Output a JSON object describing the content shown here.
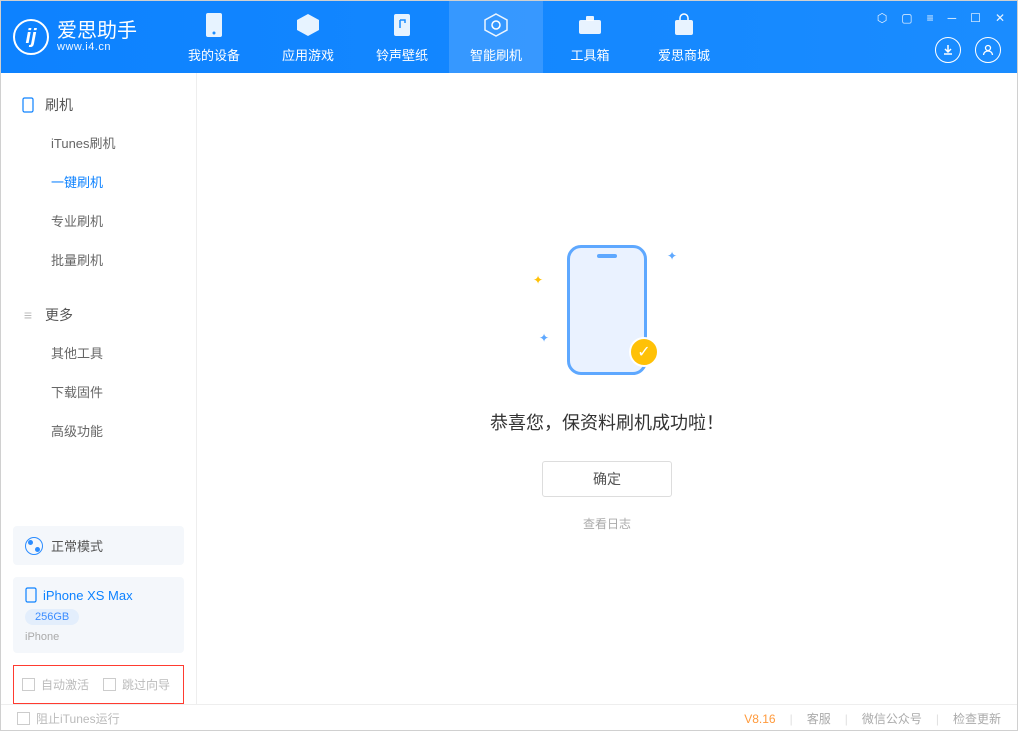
{
  "app": {
    "name": "爱思助手",
    "site": "www.i4.cn"
  },
  "nav": [
    {
      "id": "device",
      "label": "我的设备"
    },
    {
      "id": "apps",
      "label": "应用游戏"
    },
    {
      "id": "ring",
      "label": "铃声壁纸"
    },
    {
      "id": "flash",
      "label": "智能刷机"
    },
    {
      "id": "tools",
      "label": "工具箱"
    },
    {
      "id": "store",
      "label": "爱思商城"
    }
  ],
  "sidebar": {
    "sec1": {
      "title": "刷机",
      "items": [
        "iTunes刷机",
        "一键刷机",
        "专业刷机",
        "批量刷机"
      ]
    },
    "sec2": {
      "title": "更多",
      "items": [
        "其他工具",
        "下载固件",
        "高级功能"
      ]
    }
  },
  "mode": {
    "label": "正常模式"
  },
  "device": {
    "name": "iPhone XS Max",
    "capacity": "256GB",
    "type": "iPhone"
  },
  "options": {
    "o1": "自动激活",
    "o2": "跳过向导"
  },
  "main": {
    "success": "恭喜您，保资料刷机成功啦！",
    "ok": "确定",
    "log": "查看日志"
  },
  "footer": {
    "block": "阻止iTunes运行",
    "version": "V8.16",
    "support": "客服",
    "wechat": "微信公众号",
    "update": "检查更新"
  }
}
